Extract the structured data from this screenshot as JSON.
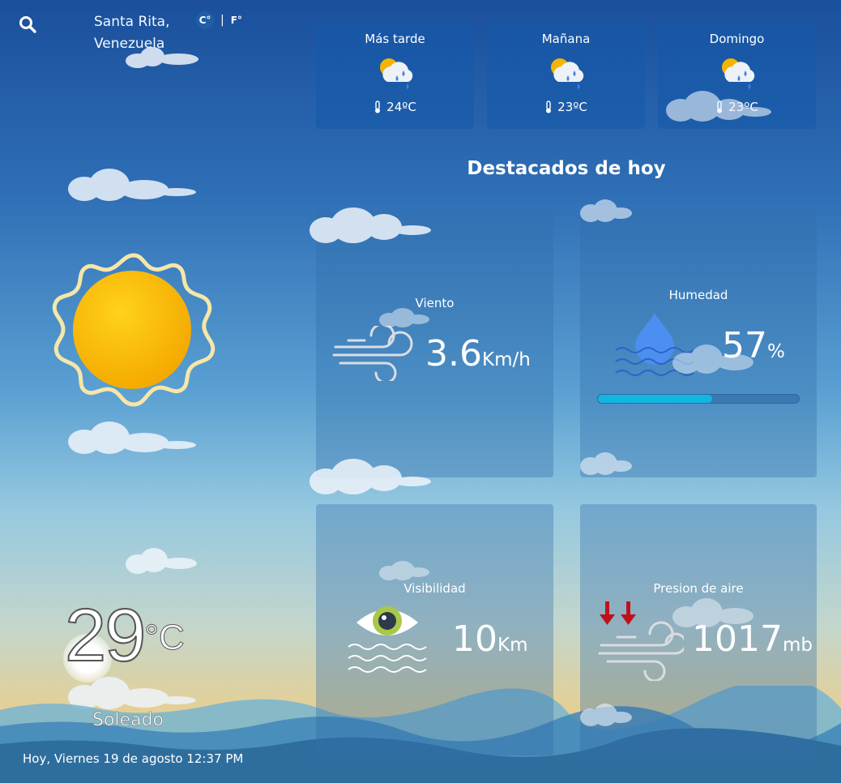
{
  "location": {
    "city": "Santa Rita,",
    "country": "Venezuela"
  },
  "units": {
    "celsius": "C°",
    "separator": "|",
    "fahrenheit": "F°"
  },
  "current": {
    "temperature": "29",
    "unit": "°C",
    "condition": "Soleado",
    "date": "Hoy, Viernes 19 de agosto 12:37 PM"
  },
  "forecast": [
    {
      "label": "Más tarde",
      "temp": "24ºC",
      "icon": "partly-cloudy-rain-icon"
    },
    {
      "label": "Mañana",
      "temp": "23ºC",
      "icon": "partly-cloudy-rain-icon"
    },
    {
      "label": "Domingo",
      "temp": "23ºC",
      "icon": "partly-cloudy-rain-icon"
    }
  ],
  "highlights": {
    "title": "Destacados de hoy",
    "wind": {
      "label": "Viento",
      "value": "3.6",
      "unit": "Km/h",
      "icon": "wind-icon"
    },
    "humidity": {
      "label": "Humedad",
      "value": "57",
      "unit": "%",
      "percent": 57,
      "icon": "water-drop-icon"
    },
    "visibility": {
      "label": "Visibilidad",
      "value": "10",
      "unit": "Km",
      "icon": "eye-icon"
    },
    "pressure": {
      "label": "Presion de aire",
      "value": "1017",
      "unit": "mb",
      "icon": "pressure-down-icon"
    }
  },
  "colors": {
    "humidity_bar": "#13b6de",
    "pressure_arrows": "#c0111b",
    "sun": "#f8c300"
  }
}
